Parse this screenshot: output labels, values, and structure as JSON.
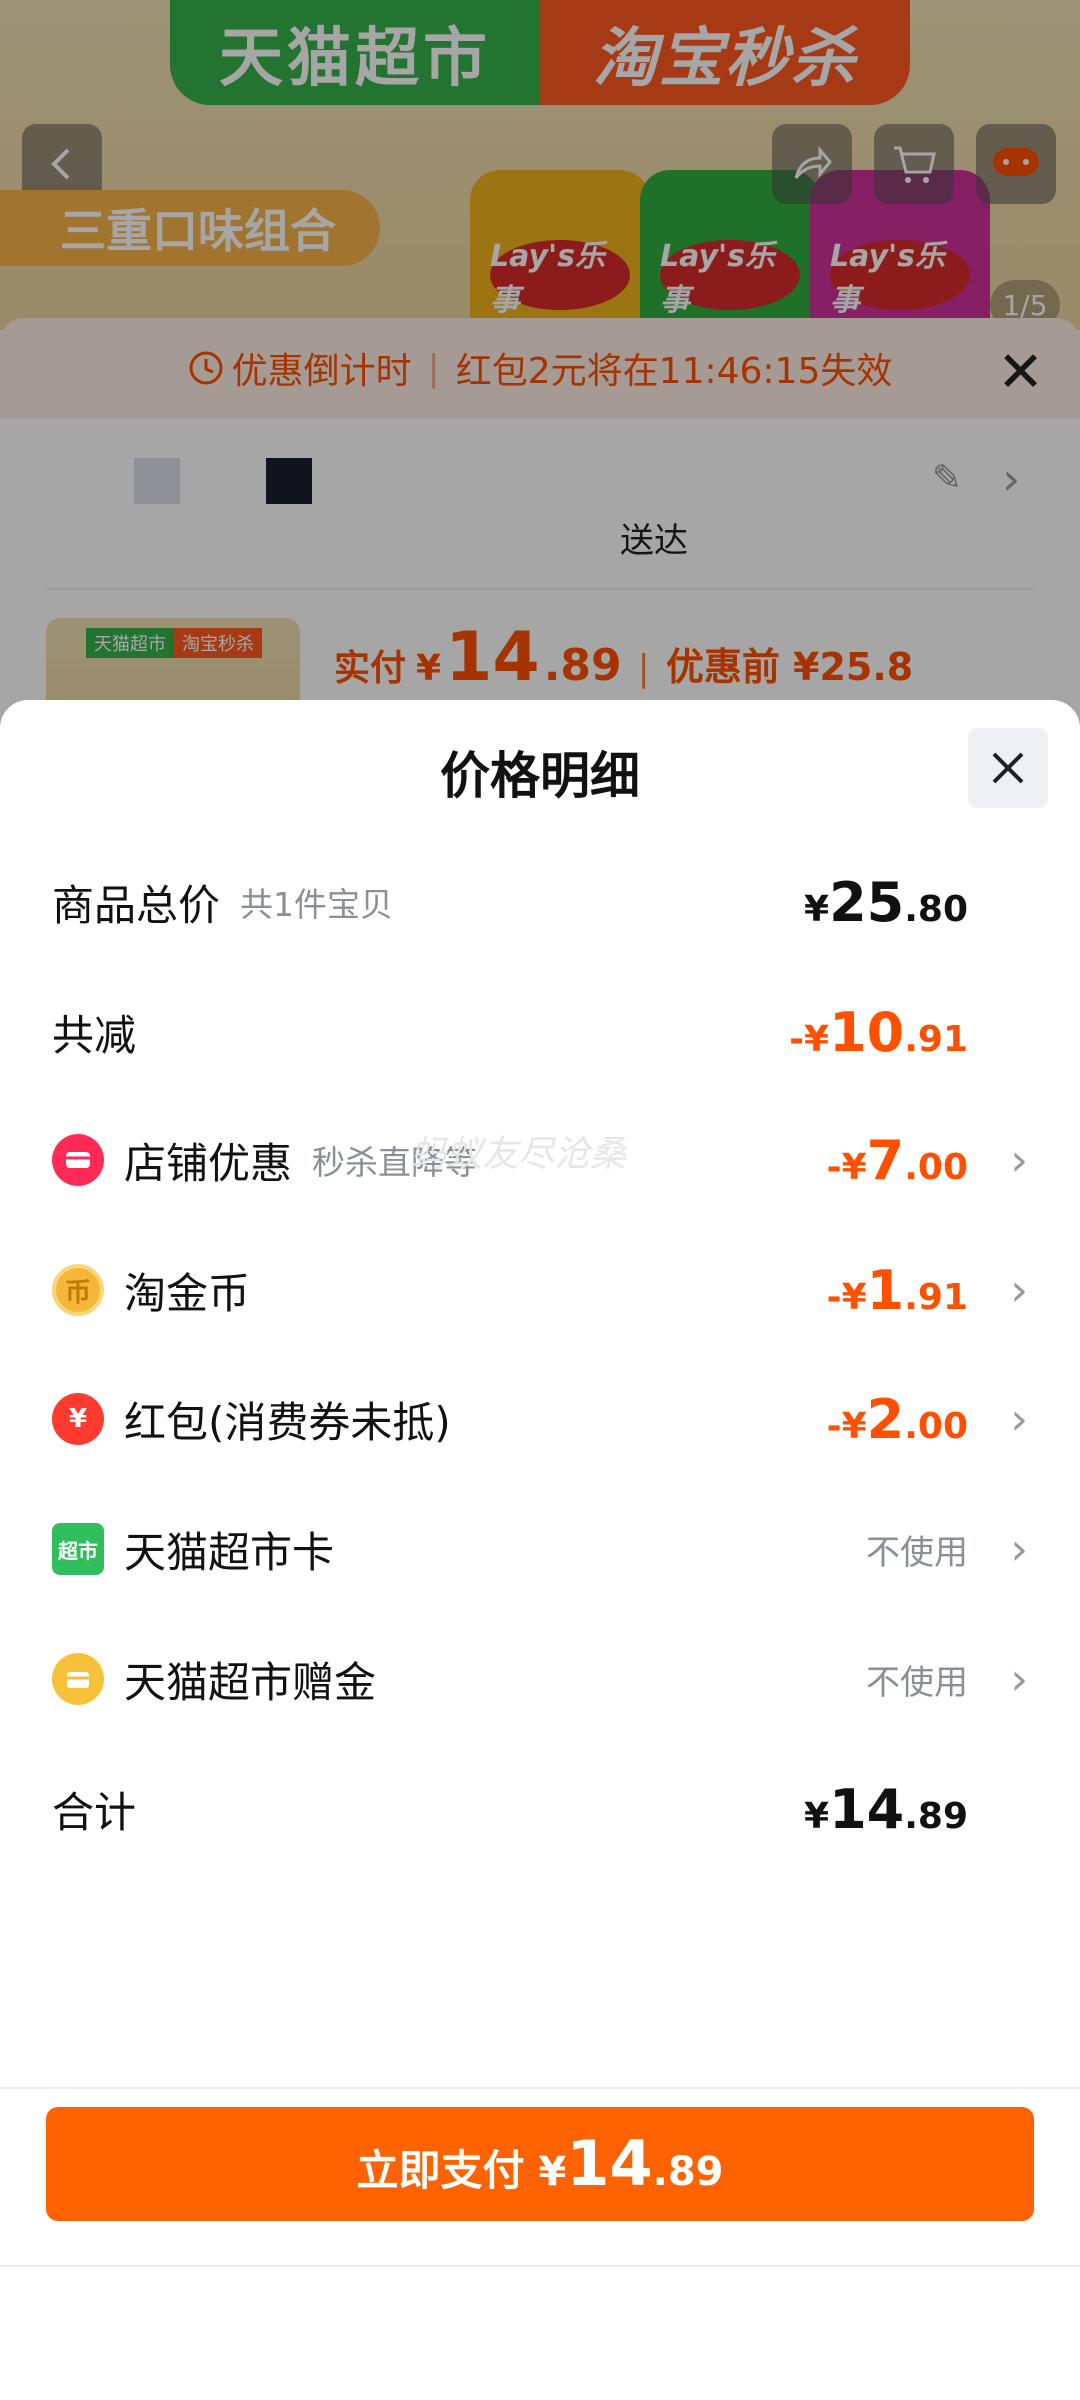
{
  "background": {
    "banner_left": "天猫超市",
    "banner_right": "淘宝秒杀",
    "promo_tag": "三重口味组合",
    "can_logo": "Lay's乐事",
    "page_indicator": "1/5",
    "countdown_label": "优惠倒计时",
    "countdown_text": "红包2元将在11:46:15失效",
    "delivery_suffix": "送达",
    "pay_label": "实付",
    "pay_currency": "¥",
    "pay_int": "14",
    "pay_dec": ".89",
    "before_text": "优惠前 ¥25.8",
    "thumb_tag1": "天猫超市",
    "thumb_tag2": "淘宝秒杀"
  },
  "sheet": {
    "title": "价格明细",
    "rows": [
      {
        "label": "商品总价",
        "sub": "共1件宝贝",
        "cur": "¥",
        "int": "25",
        "dec": ".80",
        "negative": false
      },
      {
        "label": "共减",
        "cur": "-¥",
        "int": "10",
        "dec": ".91",
        "negative": true
      },
      {
        "label": "店铺优惠",
        "sub": "秒杀直降等",
        "cur": "-¥",
        "int": "7",
        "dec": ".00",
        "negative": true,
        "icon": "shop-icon"
      },
      {
        "label": "淘金币",
        "cur": "-¥",
        "int": "1",
        "dec": ".91",
        "negative": true,
        "icon": "coin-icon"
      },
      {
        "label": "红包(消费券未抵)",
        "cur": "-¥",
        "int": "2",
        "dec": ".00",
        "negative": true,
        "icon": "red-packet-icon"
      },
      {
        "label": "天猫超市卡",
        "status": "不使用",
        "icon": "supermarket-card-icon"
      },
      {
        "label": "天猫超市赠金",
        "status": "不使用",
        "icon": "gift-money-icon"
      },
      {
        "label": "合计",
        "cur": "¥",
        "int": "14",
        "dec": ".89",
        "negative": false
      }
    ],
    "card_icon_text": "超市",
    "coin_icon_text": "币",
    "hb_icon_text": "¥",
    "watermark": "蚂蚁友尽沧桑"
  },
  "pay_button": {
    "label": "立即支付",
    "cur": "¥",
    "int": "14",
    "dec": ".89"
  },
  "colors": {
    "accent": "#ff5000",
    "button": "#ff6200"
  }
}
